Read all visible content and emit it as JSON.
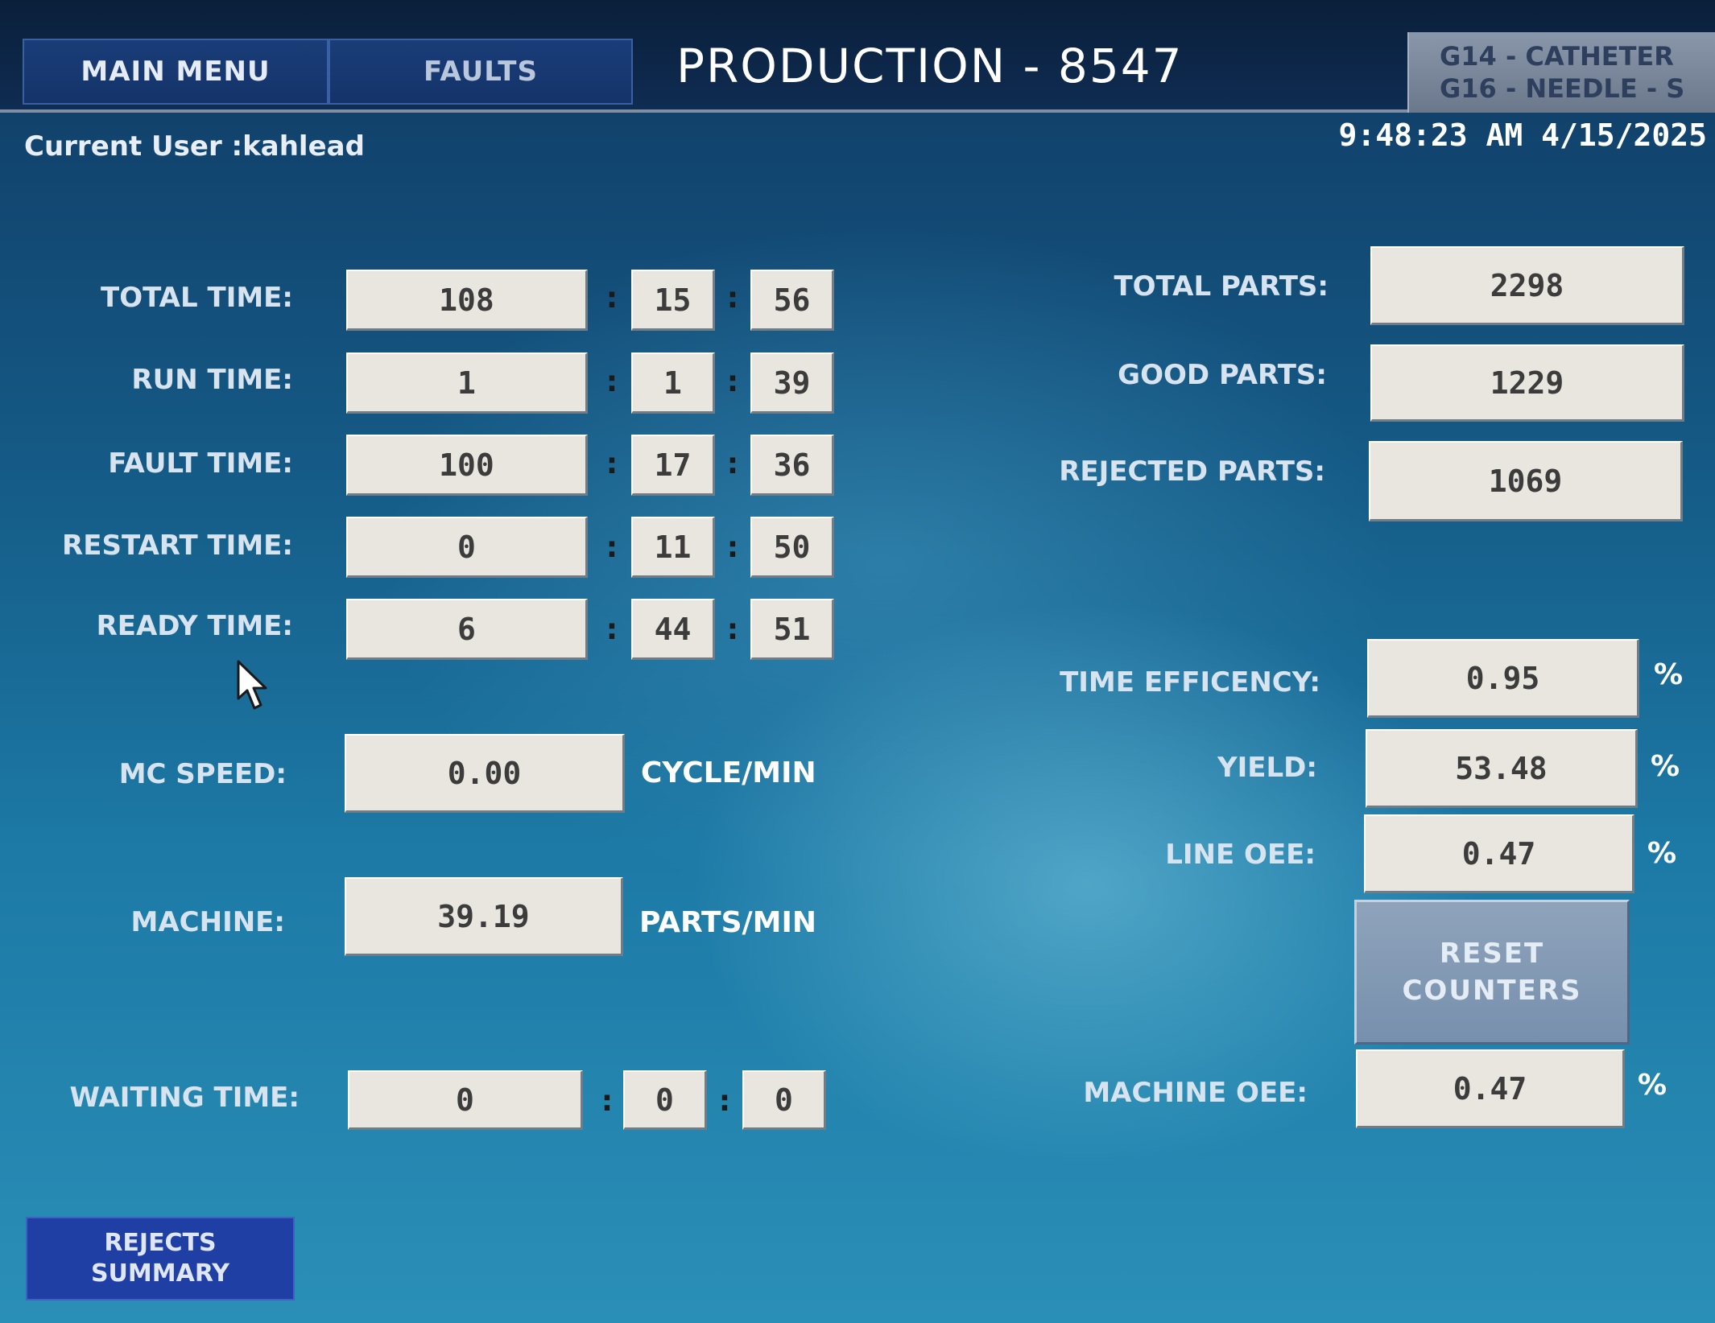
{
  "header": {
    "main_menu": "MAIN MENU",
    "faults": "FAULTS",
    "title": "PRODUCTION - 8547",
    "product_line1": "G14 - CATHETER",
    "product_line2": "G16 - NEEDLE - S"
  },
  "status": {
    "current_user": "Current User :kahlead",
    "datetime": "9:48:23 AM 4/15/2025"
  },
  "times": [
    {
      "label": "TOTAL TIME:",
      "h": "108",
      "m": "15",
      "s": "56"
    },
    {
      "label": "RUN TIME:",
      "h": "1",
      "m": "1",
      "s": "39"
    },
    {
      "label": "FAULT TIME:",
      "h": "100",
      "m": "17",
      "s": "36"
    },
    {
      "label": "RESTART TIME:",
      "h": "0",
      "m": "11",
      "s": "50"
    },
    {
      "label": "READY TIME:",
      "h": "6",
      "m": "44",
      "s": "51"
    }
  ],
  "waiting": {
    "label": "WAITING TIME:",
    "h": "0",
    "m": "0",
    "s": "0"
  },
  "speed": {
    "mc_label": "MC SPEED:",
    "mc_value": "0.00",
    "mc_unit": "CYCLE/MIN",
    "machine_label": "MACHINE:",
    "machine_value": "39.19",
    "machine_unit": "PARTS/MIN"
  },
  "parts": {
    "total_label": "TOTAL PARTS:",
    "total": "2298",
    "good_label": "GOOD PARTS:",
    "good": "1229",
    "rejected_label": "REJECTED PARTS:",
    "rejected": "1069"
  },
  "efficiency": {
    "time_label": "TIME EFFICENCY:",
    "time": "0.95",
    "yield_label": "YIELD:",
    "yield": "53.48",
    "line_oee_label": "LINE OEE:",
    "line_oee": "0.47",
    "machine_oee_label": "MACHINE OEE:",
    "machine_oee": "0.47",
    "pct": "%"
  },
  "buttons": {
    "reset_line1": "RESET",
    "reset_line2": "COUNTERS",
    "rejects_line1": "REJECTS",
    "rejects_line2": "SUMMARY"
  },
  "colon": ":"
}
